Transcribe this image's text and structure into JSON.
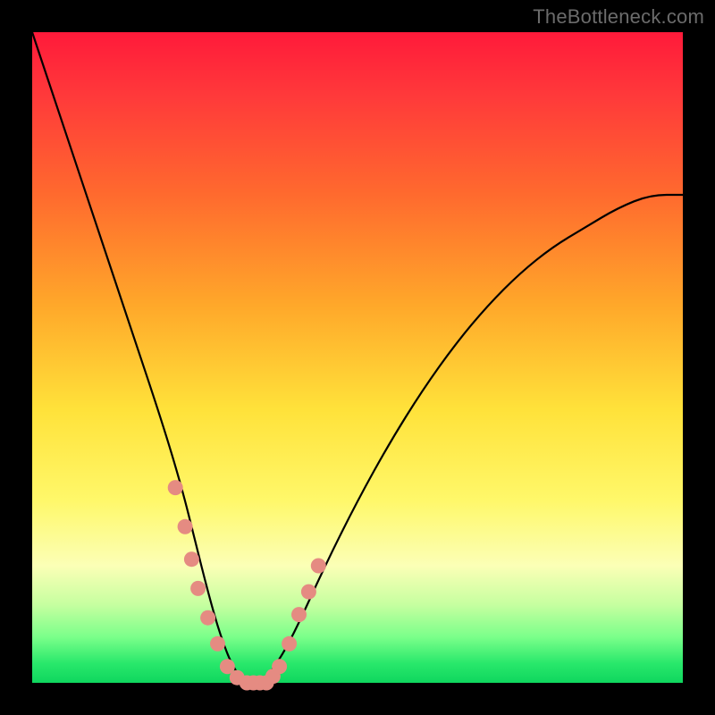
{
  "watermark": "TheBottleneck.com",
  "colors": {
    "frame": "#000000",
    "curve_stroke": "#000000",
    "marker": "#e58b82",
    "gradient_top": "#ff1a3a",
    "gradient_bottom": "#0fd65e"
  },
  "chart_data": {
    "type": "line",
    "title": "",
    "xlabel": "",
    "ylabel": "",
    "xlim": [
      0,
      100
    ],
    "ylim": [
      0,
      100
    ],
    "grid": false,
    "legend": false,
    "series": [
      {
        "name": "bottleneck-curve",
        "x": [
          0,
          5,
          10,
          15,
          20,
          23,
          25,
          27,
          29,
          31,
          33,
          35,
          37,
          40,
          45,
          50,
          55,
          60,
          65,
          70,
          75,
          80,
          85,
          90,
          95,
          100
        ],
        "values": [
          100,
          85,
          70,
          55,
          40,
          30,
          22,
          14,
          7,
          2,
          0,
          0,
          2,
          7,
          18,
          28,
          37,
          45,
          52,
          58,
          63,
          67,
          70,
          73,
          75,
          75
        ]
      }
    ],
    "markers": {
      "name": "highlight-points",
      "x": [
        22,
        23.5,
        24.5,
        25.5,
        27,
        28.5,
        30,
        31.5,
        33,
        34,
        35,
        36,
        37,
        38,
        39.5,
        41,
        42.5,
        44
      ],
      "values": [
        30,
        24,
        19,
        14.5,
        10,
        6,
        2.5,
        0.8,
        0,
        0,
        0,
        0,
        1,
        2.5,
        6,
        10.5,
        14,
        18
      ]
    },
    "annotations": []
  }
}
